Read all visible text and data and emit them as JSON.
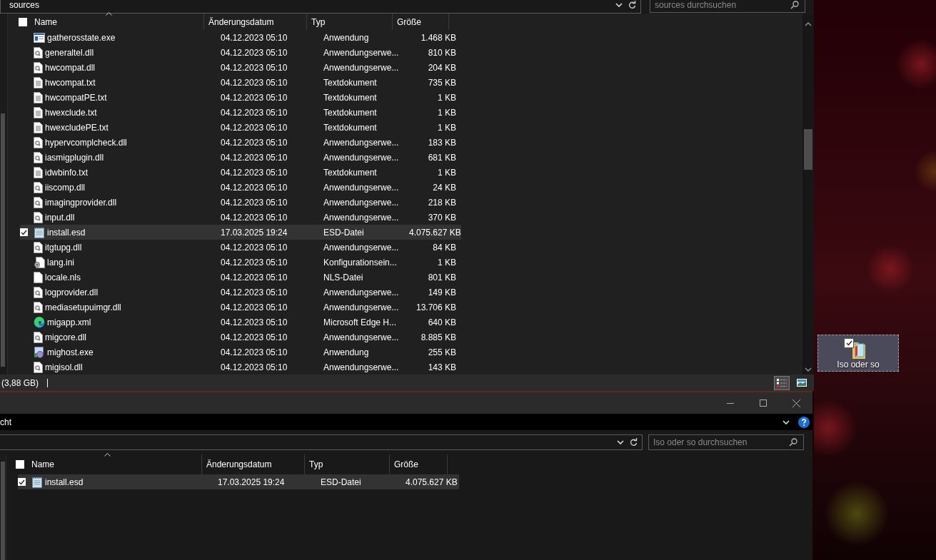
{
  "top_window": {
    "address": {
      "path": "sources",
      "search_placeholder": "sources durchsuchen"
    },
    "header_checked": false,
    "columns": [
      "Name",
      "Änderungsdatum",
      "Typ",
      "Größe"
    ],
    "rows": [
      {
        "kind": "exe",
        "name": "gatherosstate.exe",
        "date": "04.12.2023 05:10",
        "type": "Anwendung",
        "size": "1.468 KB",
        "checked": false,
        "selected": false
      },
      {
        "kind": "dll",
        "name": "generaltel.dll",
        "date": "04.12.2023 05:10",
        "type": "Anwendungserwe...",
        "size": "810 KB",
        "checked": false,
        "selected": false
      },
      {
        "kind": "dll",
        "name": "hwcompat.dll",
        "date": "04.12.2023 05:10",
        "type": "Anwendungserwe...",
        "size": "204 KB",
        "checked": false,
        "selected": false
      },
      {
        "kind": "txt",
        "name": "hwcompat.txt",
        "date": "04.12.2023 05:10",
        "type": "Textdokument",
        "size": "735 KB",
        "checked": false,
        "selected": false
      },
      {
        "kind": "txt",
        "name": "hwcompatPE.txt",
        "date": "04.12.2023 05:10",
        "type": "Textdokument",
        "size": "1 KB",
        "checked": false,
        "selected": false
      },
      {
        "kind": "txt",
        "name": "hwexclude.txt",
        "date": "04.12.2023 05:10",
        "type": "Textdokument",
        "size": "1 KB",
        "checked": false,
        "selected": false
      },
      {
        "kind": "txt",
        "name": "hwexcludePE.txt",
        "date": "04.12.2023 05:10",
        "type": "Textdokument",
        "size": "1 KB",
        "checked": false,
        "selected": false
      },
      {
        "kind": "dll",
        "name": "hypervcomplcheck.dll",
        "date": "04.12.2023 05:10",
        "type": "Anwendungserwe...",
        "size": "183 KB",
        "checked": false,
        "selected": false
      },
      {
        "kind": "dll",
        "name": "iasmigplugin.dll",
        "date": "04.12.2023 05:10",
        "type": "Anwendungserwe...",
        "size": "681 KB",
        "checked": false,
        "selected": false
      },
      {
        "kind": "txt",
        "name": "idwbinfo.txt",
        "date": "04.12.2023 05:10",
        "type": "Textdokument",
        "size": "1 KB",
        "checked": false,
        "selected": false
      },
      {
        "kind": "dll",
        "name": "iiscomp.dll",
        "date": "04.12.2023 05:10",
        "type": "Anwendungserwe...",
        "size": "24 KB",
        "checked": false,
        "selected": false
      },
      {
        "kind": "dll",
        "name": "imagingprovider.dll",
        "date": "04.12.2023 05:10",
        "type": "Anwendungserwe...",
        "size": "218 KB",
        "checked": false,
        "selected": false
      },
      {
        "kind": "dll",
        "name": "input.dll",
        "date": "04.12.2023 05:10",
        "type": "Anwendungserwe...",
        "size": "370 KB",
        "checked": false,
        "selected": false
      },
      {
        "kind": "esd",
        "name": "install.esd",
        "date": "17.03.2025 19:24",
        "type": "ESD-Datei",
        "size": "4.075.627 KB",
        "checked": true,
        "selected": true
      },
      {
        "kind": "dll",
        "name": "itgtupg.dll",
        "date": "04.12.2023 05:10",
        "type": "Anwendungserwe...",
        "size": "84 KB",
        "checked": false,
        "selected": false
      },
      {
        "kind": "ini",
        "name": "lang.ini",
        "date": "04.12.2023 05:10",
        "type": "Konfigurationsein...",
        "size": "1 KB",
        "checked": false,
        "selected": false
      },
      {
        "kind": "blank",
        "name": "locale.nls",
        "date": "04.12.2023 05:10",
        "type": "NLS-Datei",
        "size": "801 KB",
        "checked": false,
        "selected": false
      },
      {
        "kind": "dll",
        "name": "logprovider.dll",
        "date": "04.12.2023 05:10",
        "type": "Anwendungserwe...",
        "size": "149 KB",
        "checked": false,
        "selected": false
      },
      {
        "kind": "dll",
        "name": "mediasetupuimgr.dll",
        "date": "04.12.2023 05:10",
        "type": "Anwendungserwe...",
        "size": "13.706 KB",
        "checked": false,
        "selected": false
      },
      {
        "kind": "edge",
        "name": "migapp.xml",
        "date": "04.12.2023 05:10",
        "type": "Microsoft Edge H...",
        "size": "640 KB",
        "checked": false,
        "selected": false
      },
      {
        "kind": "dll",
        "name": "migcore.dll",
        "date": "04.12.2023 05:10",
        "type": "Anwendungserwe...",
        "size": "8.885 KB",
        "checked": false,
        "selected": false
      },
      {
        "kind": "setup",
        "name": "mighost.exe",
        "date": "04.12.2023 05:10",
        "type": "Anwendung",
        "size": "255 KB",
        "checked": false,
        "selected": false
      },
      {
        "kind": "dll",
        "name": "migisol.dll",
        "date": "04.12.2023 05:10",
        "type": "Anwendungserwe...",
        "size": "143 KB",
        "checked": false,
        "selected": false
      }
    ],
    "status_text": "(3,88 GB)",
    "view_modes": [
      {
        "kind": "details",
        "selected": true
      },
      {
        "kind": "tiles",
        "selected": false
      }
    ]
  },
  "bottom_window": {
    "ribbon_text": "cht",
    "search_placeholder": "Iso oder so durchsuchen",
    "header_checked": false,
    "columns": [
      "Name",
      "Änderungsdatum",
      "Typ",
      "Größe"
    ],
    "rows": [
      {
        "kind": "esd",
        "name": "install.esd",
        "date": "17.03.2025 19:24",
        "type": "ESD-Datei",
        "size": "4.075.627 KB",
        "checked": true,
        "selected": true
      }
    ]
  },
  "desktop": {
    "icons": [
      {
        "label": "Iso oder so",
        "selected": true,
        "checked": true
      }
    ]
  }
}
